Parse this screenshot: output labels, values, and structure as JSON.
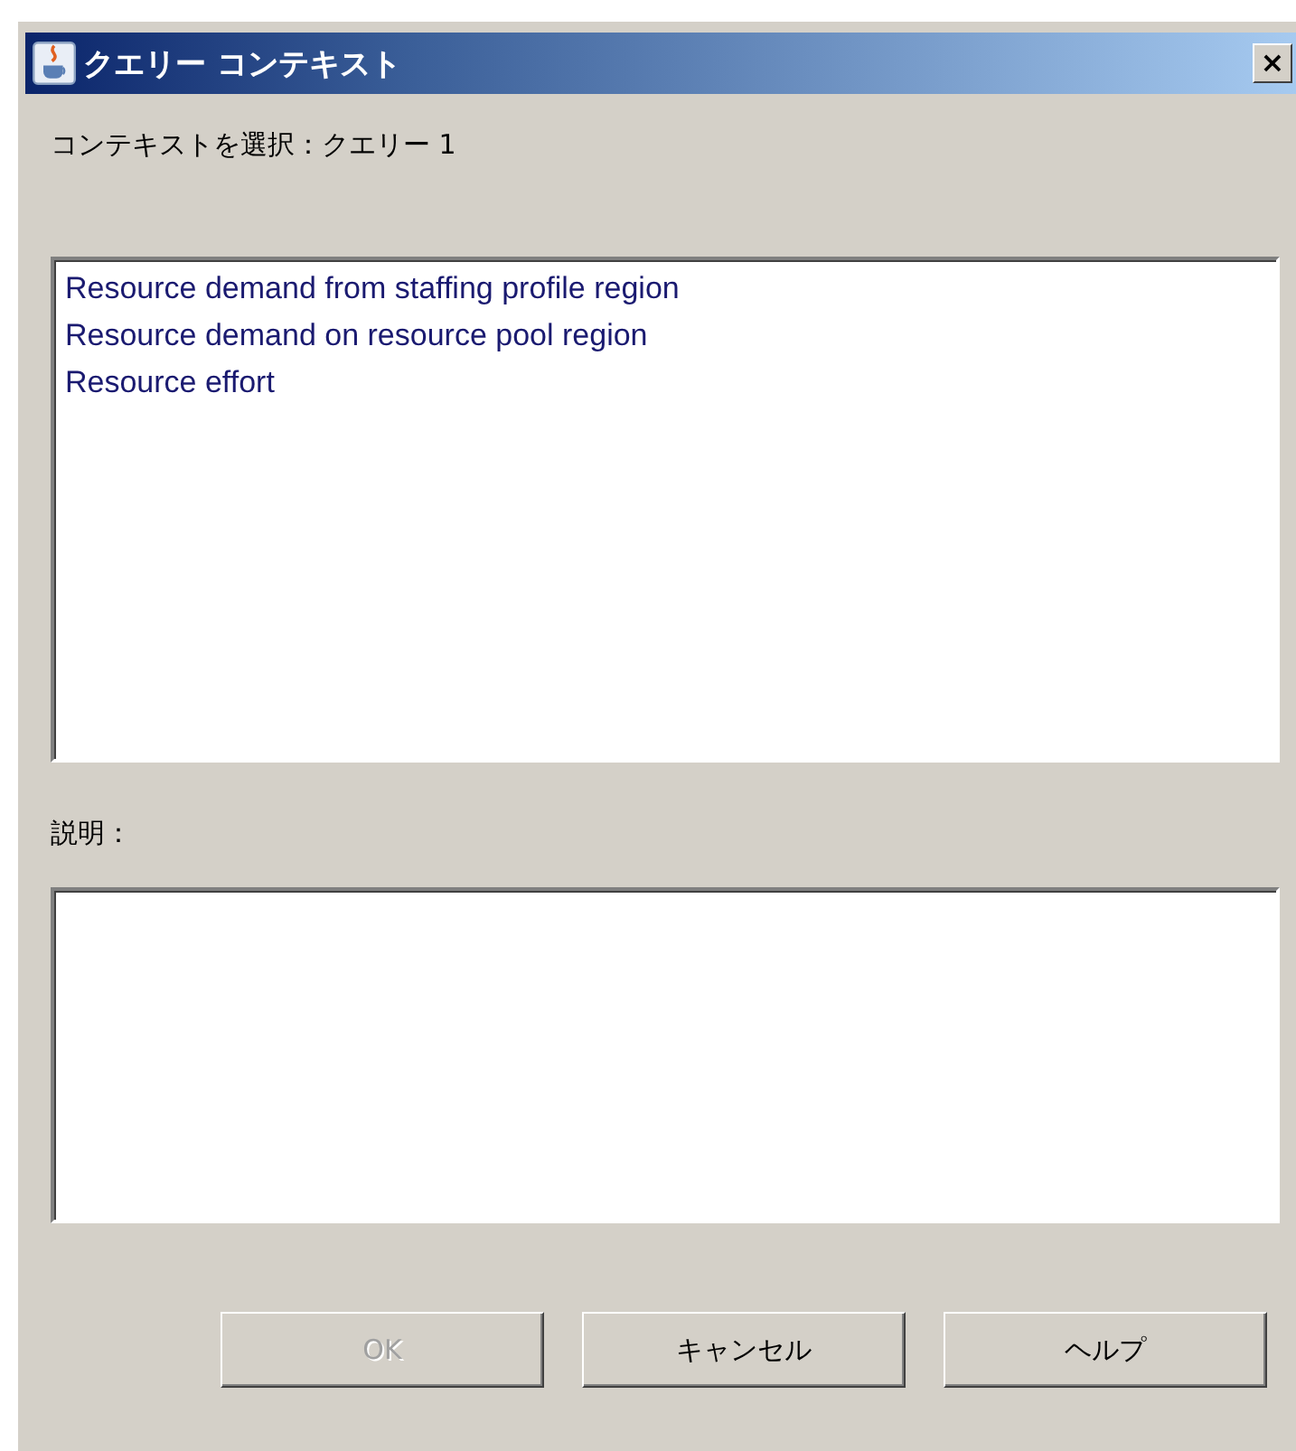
{
  "window": {
    "title": "クエリー コンテキスト",
    "close": "×"
  },
  "context_label": "コンテキストを選択：クエリー 1",
  "contexts": [
    {
      "label": "Resource demand from staffing profile region",
      "selected": false
    },
    {
      "label": "Resource demand on resource pool region",
      "selected": false
    },
    {
      "label": "Resource effort",
      "selected": false
    }
  ],
  "description_label": "説明：",
  "buttons": [
    {
      "label": "OK",
      "disabled": true
    },
    {
      "label": "キャンセル",
      "disabled": false
    },
    {
      "label": "ヘルプ",
      "disabled": false
    }
  ]
}
